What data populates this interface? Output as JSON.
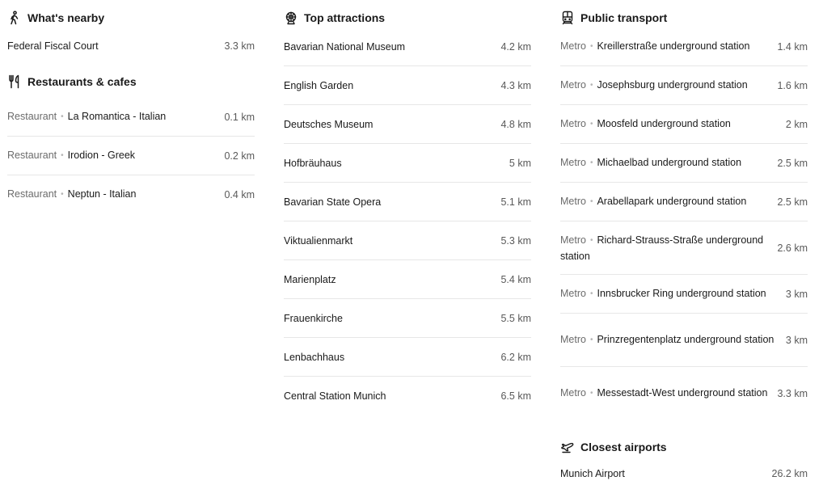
{
  "nearby": {
    "title": "What's nearby",
    "icon": "walking-person-icon",
    "items": [
      {
        "name": "Federal Fiscal Court",
        "distance": "3.3 km"
      }
    ]
  },
  "restaurants": {
    "title": "Restaurants & cafes",
    "icon": "fork-knife-icon",
    "items": [
      {
        "category": "Restaurant",
        "name": "La Romantica - Italian",
        "distance": "0.1 km"
      },
      {
        "category": "Restaurant",
        "name": "Irodion - Greek",
        "distance": "0.2 km"
      },
      {
        "category": "Restaurant",
        "name": "Neptun - Italian",
        "distance": "0.4 km"
      }
    ]
  },
  "attractions": {
    "title": "Top attractions",
    "icon": "attraction-icon",
    "items": [
      {
        "name": "Bavarian National Museum",
        "distance": "4.2 km"
      },
      {
        "name": "English Garden",
        "distance": "4.3 km"
      },
      {
        "name": "Deutsches Museum",
        "distance": "4.8 km"
      },
      {
        "name": "Hofbräuhaus",
        "distance": "5 km"
      },
      {
        "name": "Bavarian State Opera",
        "distance": "5.1 km"
      },
      {
        "name": "Viktualienmarkt",
        "distance": "5.3 km"
      },
      {
        "name": "Marienplatz",
        "distance": "5.4 km"
      },
      {
        "name": "Frauenkirche",
        "distance": "5.5 km"
      },
      {
        "name": "Lenbachhaus",
        "distance": "6.2 km"
      },
      {
        "name": "Central Station Munich",
        "distance": "6.5 km"
      }
    ]
  },
  "transport": {
    "title": "Public transport",
    "icon": "train-icon",
    "items": [
      {
        "category": "Metro",
        "name": "Kreillerstraße underground station",
        "distance": "1.4 km"
      },
      {
        "category": "Metro",
        "name": "Josephsburg underground station",
        "distance": "1.6 km"
      },
      {
        "category": "Metro",
        "name": "Moosfeld underground station",
        "distance": "2 km"
      },
      {
        "category": "Metro",
        "name": "Michaelbad underground station",
        "distance": "2.5 km"
      },
      {
        "category": "Metro",
        "name": "Arabellapark underground station",
        "distance": "2.5 km"
      },
      {
        "category": "Metro",
        "name": "Richard-Strauss-Straße underground station",
        "distance": "2.6 km"
      },
      {
        "category": "Metro",
        "name": "Innsbrucker Ring underground station",
        "distance": "3 km"
      },
      {
        "category": "Metro",
        "name": "Prinzregentenplatz underground station",
        "distance": "3 km"
      },
      {
        "category": "Metro",
        "name": "Messestadt-West underground station",
        "distance": "3.3 km"
      }
    ]
  },
  "airports": {
    "title": "Closest airports",
    "icon": "airplane-icon",
    "items": [
      {
        "name": "Munich Airport",
        "distance": "26.2 km"
      }
    ]
  },
  "separator": "•"
}
